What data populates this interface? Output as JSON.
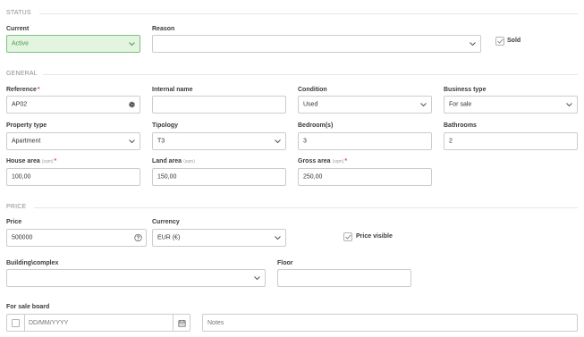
{
  "status": {
    "section_title": "STATUS",
    "current": {
      "label": "Current",
      "value": "Active"
    },
    "reason": {
      "label": "Reason",
      "value": ""
    },
    "sold": {
      "label": "Sold",
      "checked": true
    }
  },
  "general": {
    "section_title": "GENERAL",
    "reference": {
      "label": "Reference",
      "value": "AP02"
    },
    "internal_name": {
      "label": "Internal name",
      "value": ""
    },
    "condition": {
      "label": "Condition",
      "value": "Used"
    },
    "business_type": {
      "label": "Business type",
      "value": "For sale"
    },
    "property_type": {
      "label": "Property type",
      "value": "Apartment"
    },
    "tipology": {
      "label": "Tipology",
      "value": "T3"
    },
    "bedrooms": {
      "label": "Bedroom(s)",
      "value": "3"
    },
    "bathrooms": {
      "label": "Bathrooms",
      "value": "2"
    },
    "house_area": {
      "label": "House area",
      "unit": "(sqm)",
      "value": "100,00"
    },
    "land_area": {
      "label": "Land area",
      "unit": "(sqm)",
      "value": "150,00"
    },
    "gross_area": {
      "label": "Gross area",
      "unit": "(sqm)",
      "value": "250,00"
    }
  },
  "price": {
    "section_title": "PRICE",
    "price": {
      "label": "Price",
      "value": "500000"
    },
    "currency": {
      "label": "Currency",
      "value": "EUR (€)"
    },
    "price_visible": {
      "label": "Price visible",
      "checked": true
    },
    "building_complex": {
      "label": "Building\\complex",
      "value": ""
    },
    "floor": {
      "label": "Floor",
      "value": ""
    },
    "for_sale_board": {
      "label": "For sale board",
      "checked": false,
      "date_placeholder": "DD/MM/YYYY",
      "notes_placeholder": "Notes"
    }
  },
  "required_marker": "*",
  "colors": {
    "active_bg": "#e3f5e1",
    "active_border": "#7cc37a",
    "required": "#d9534f"
  },
  "icons": {
    "dropdown": "chevron-down-icon",
    "reference": "gear-icon",
    "price": "help-circle-icon",
    "date": "calendar-icon",
    "checkbox": "check-icon"
  }
}
